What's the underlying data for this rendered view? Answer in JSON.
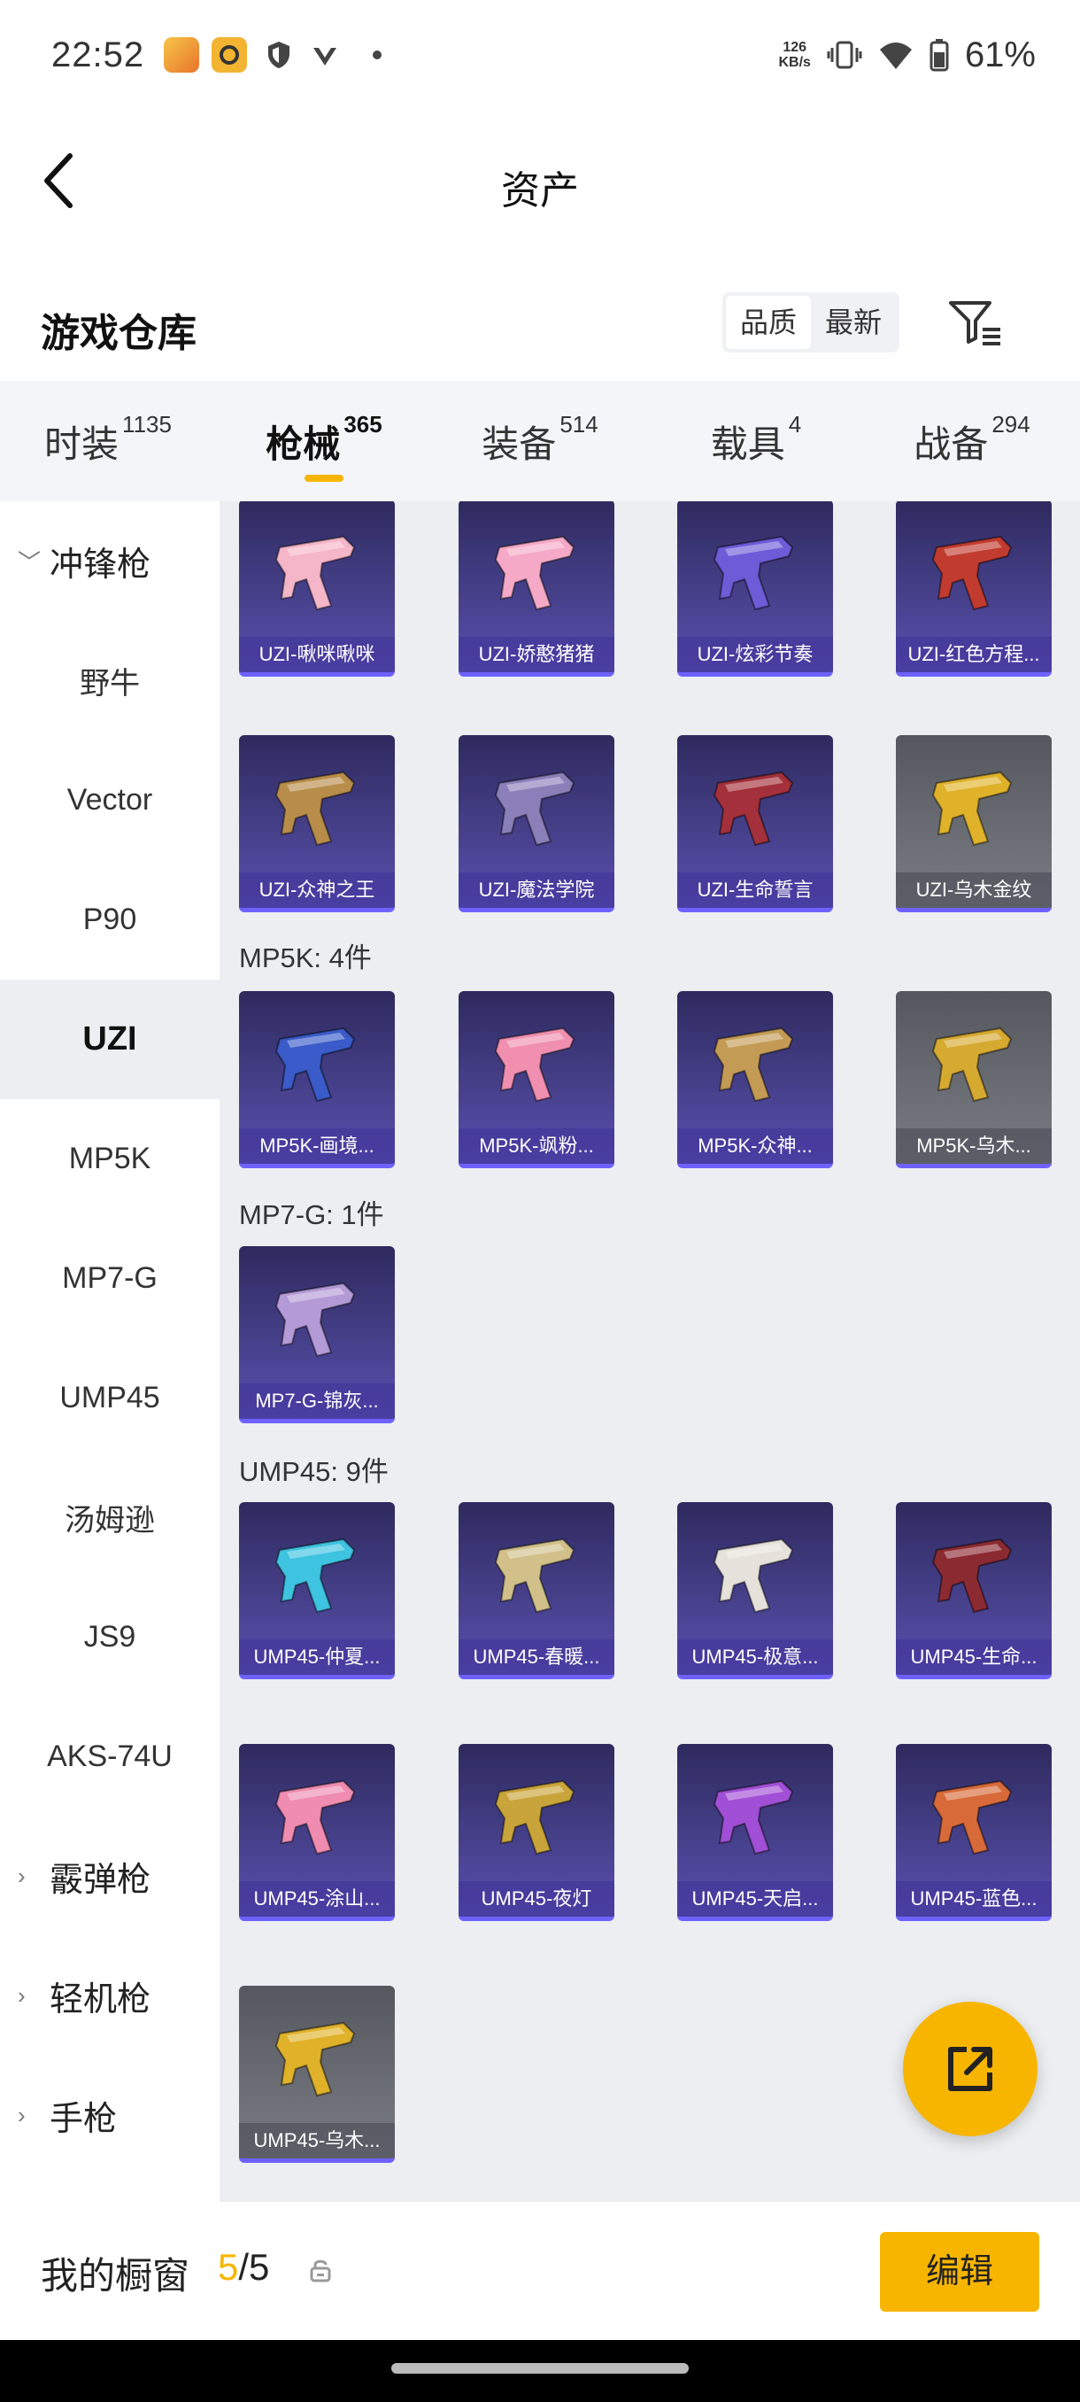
{
  "status_bar": {
    "time": "22:52",
    "speed": "126",
    "speed_unit": "KB/s",
    "battery": "61%"
  },
  "header": {
    "title": "资产"
  },
  "section": {
    "title": "游戏仓库",
    "sort_options": [
      "品质",
      "最新"
    ],
    "active_sort": "品质"
  },
  "tabs": [
    {
      "label": "时装",
      "count": "1135"
    },
    {
      "label": "枪械",
      "count": "365"
    },
    {
      "label": "装备",
      "count": "514"
    },
    {
      "label": "载具",
      "count": "4"
    },
    {
      "label": "战备",
      "count": "294"
    }
  ],
  "sidebar": {
    "items": [
      {
        "label": "冲锋枪",
        "type": "group",
        "expanded": true
      },
      {
        "label": "野牛",
        "type": "item"
      },
      {
        "label": "Vector",
        "type": "item"
      },
      {
        "label": "P90",
        "type": "item"
      },
      {
        "label": "UZI",
        "type": "item",
        "active": true
      },
      {
        "label": "MP5K",
        "type": "item"
      },
      {
        "label": "MP7-G",
        "type": "item"
      },
      {
        "label": "UMP45",
        "type": "item"
      },
      {
        "label": "汤姆逊",
        "type": "item"
      },
      {
        "label": "JS9",
        "type": "item"
      },
      {
        "label": "AKS-74U",
        "type": "item"
      },
      {
        "label": "霰弹枪",
        "type": "group",
        "expanded": false
      },
      {
        "label": "轻机枪",
        "type": "group",
        "expanded": false
      },
      {
        "label": "手枪",
        "type": "group",
        "expanded": false
      }
    ]
  },
  "groups": {
    "mp5k_title": "MP5K: 4件",
    "mp7g_title": "MP7-G: 1件",
    "ump45_title": "UMP45: 9件"
  },
  "cards": {
    "uzi": [
      {
        "label": "UZI-啾咪啾咪",
        "rarity": "purple",
        "color": "#f4b6c8"
      },
      {
        "label": "UZI-娇憨猪猪",
        "rarity": "purple",
        "color": "#f6a9c6"
      },
      {
        "label": "UZI-炫彩节奏",
        "rarity": "purple",
        "color": "#6d5bd8"
      },
      {
        "label": "UZI-红色方程...",
        "rarity": "purple",
        "color": "#c23b2f"
      },
      {
        "label": "UZI-众神之王",
        "rarity": "purple",
        "color": "#b88d4a"
      },
      {
        "label": "UZI-魔法学院",
        "rarity": "purple",
        "color": "#8a7fb8"
      },
      {
        "label": "UZI-生命誓言",
        "rarity": "purple",
        "color": "#a3303a"
      },
      {
        "label": "UZI-乌木金纹",
        "rarity": "gray",
        "color": "#e0b22a"
      }
    ],
    "mp5k": [
      {
        "label": "MP5K-画境...",
        "rarity": "purple",
        "color": "#3a5bc9"
      },
      {
        "label": "MP5K-飒粉...",
        "rarity": "purple",
        "color": "#f08fb0"
      },
      {
        "label": "MP5K-众神...",
        "rarity": "purple",
        "color": "#c49b55"
      },
      {
        "label": "MP5K-乌木...",
        "rarity": "gray",
        "color": "#d6a930"
      }
    ],
    "mp7g": [
      {
        "label": "MP7-G-锦灰...",
        "rarity": "purple",
        "color": "#b49ad6"
      }
    ],
    "ump45": [
      {
        "label": "UMP45-仲夏...",
        "rarity": "purple",
        "color": "#3ec3e0"
      },
      {
        "label": "UMP45-春暖...",
        "rarity": "purple",
        "color": "#d1c08a"
      },
      {
        "label": "UMP45-极意...",
        "rarity": "purple",
        "color": "#e6e1da"
      },
      {
        "label": "UMP45-生命...",
        "rarity": "purple",
        "color": "#8c2a32"
      },
      {
        "label": "UMP45-涂山...",
        "rarity": "purple",
        "color": "#ef8cb0"
      },
      {
        "label": "UMP45-夜灯",
        "rarity": "purple",
        "color": "#c9a43a"
      },
      {
        "label": "UMP45-天启...",
        "rarity": "purple",
        "color": "#a14fd6"
      },
      {
        "label": "UMP45-蓝色...",
        "rarity": "purple",
        "color": "#d86a3a"
      },
      {
        "label": "UMP45-乌木...",
        "rarity": "gray",
        "color": "#e0b22a"
      }
    ]
  },
  "bottom_bar": {
    "label": "我的橱窗",
    "count_current": "5",
    "count_total": "/5",
    "edit_label": "编辑"
  },
  "colors": {
    "accent": "#f7b500",
    "card_purple": "#46408a",
    "card_gray": "#6c6e75",
    "panel_bg": "#eceef2"
  }
}
